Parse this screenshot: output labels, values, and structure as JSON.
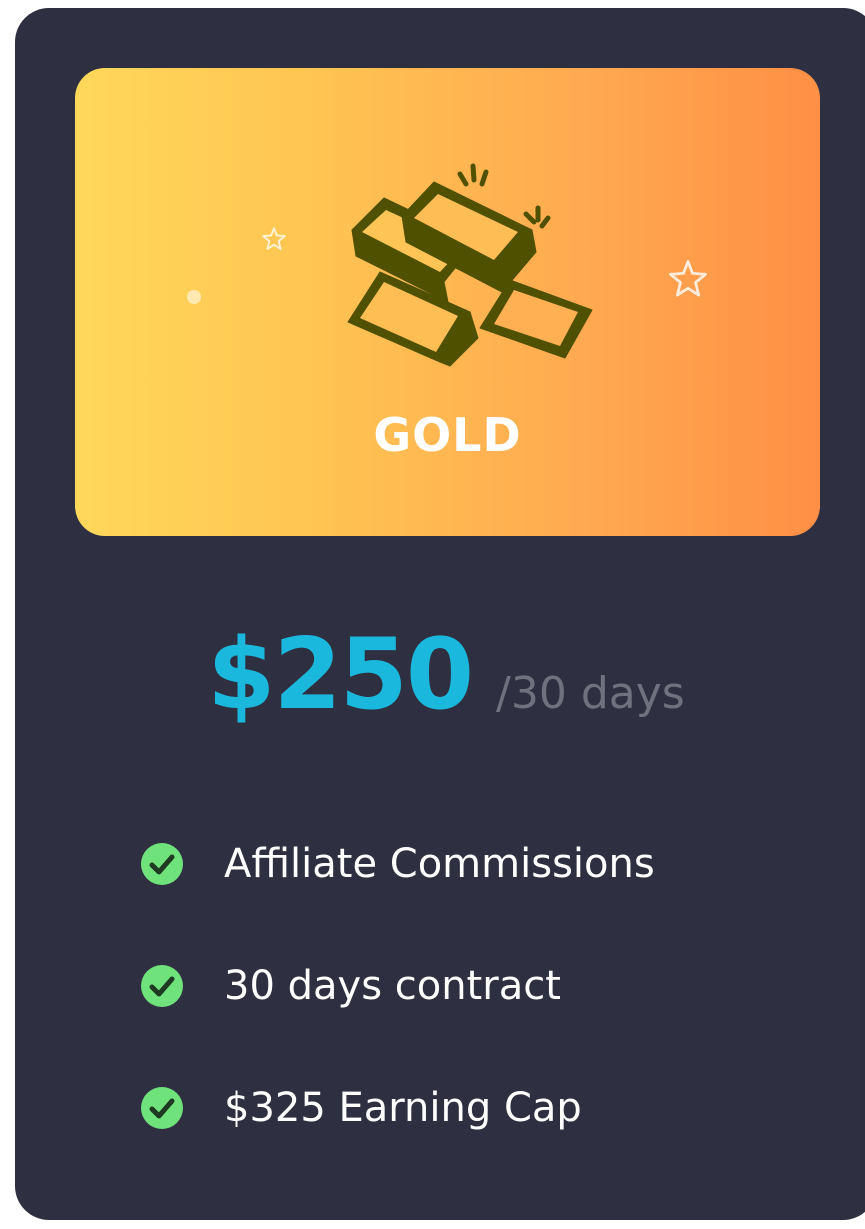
{
  "plan": {
    "name": "GOLD",
    "icon": "gold-bars-icon",
    "price": "$250",
    "period": "/30 days"
  },
  "features": [
    {
      "icon": "check-circle-icon",
      "label": "Affiliate Commissions"
    },
    {
      "icon": "check-circle-icon",
      "label": "30 days contract"
    },
    {
      "icon": "check-circle-icon",
      "label": "$325 Earning Cap"
    }
  ],
  "colors": {
    "card_background": "#2e2f41",
    "banner_gradient_start": "#ffd85a",
    "banner_gradient_end": "#ff8f45",
    "price": "#1ab8dc",
    "period": "#70717e",
    "check": "#6fe27c",
    "gold_icon": "#4f5000"
  }
}
